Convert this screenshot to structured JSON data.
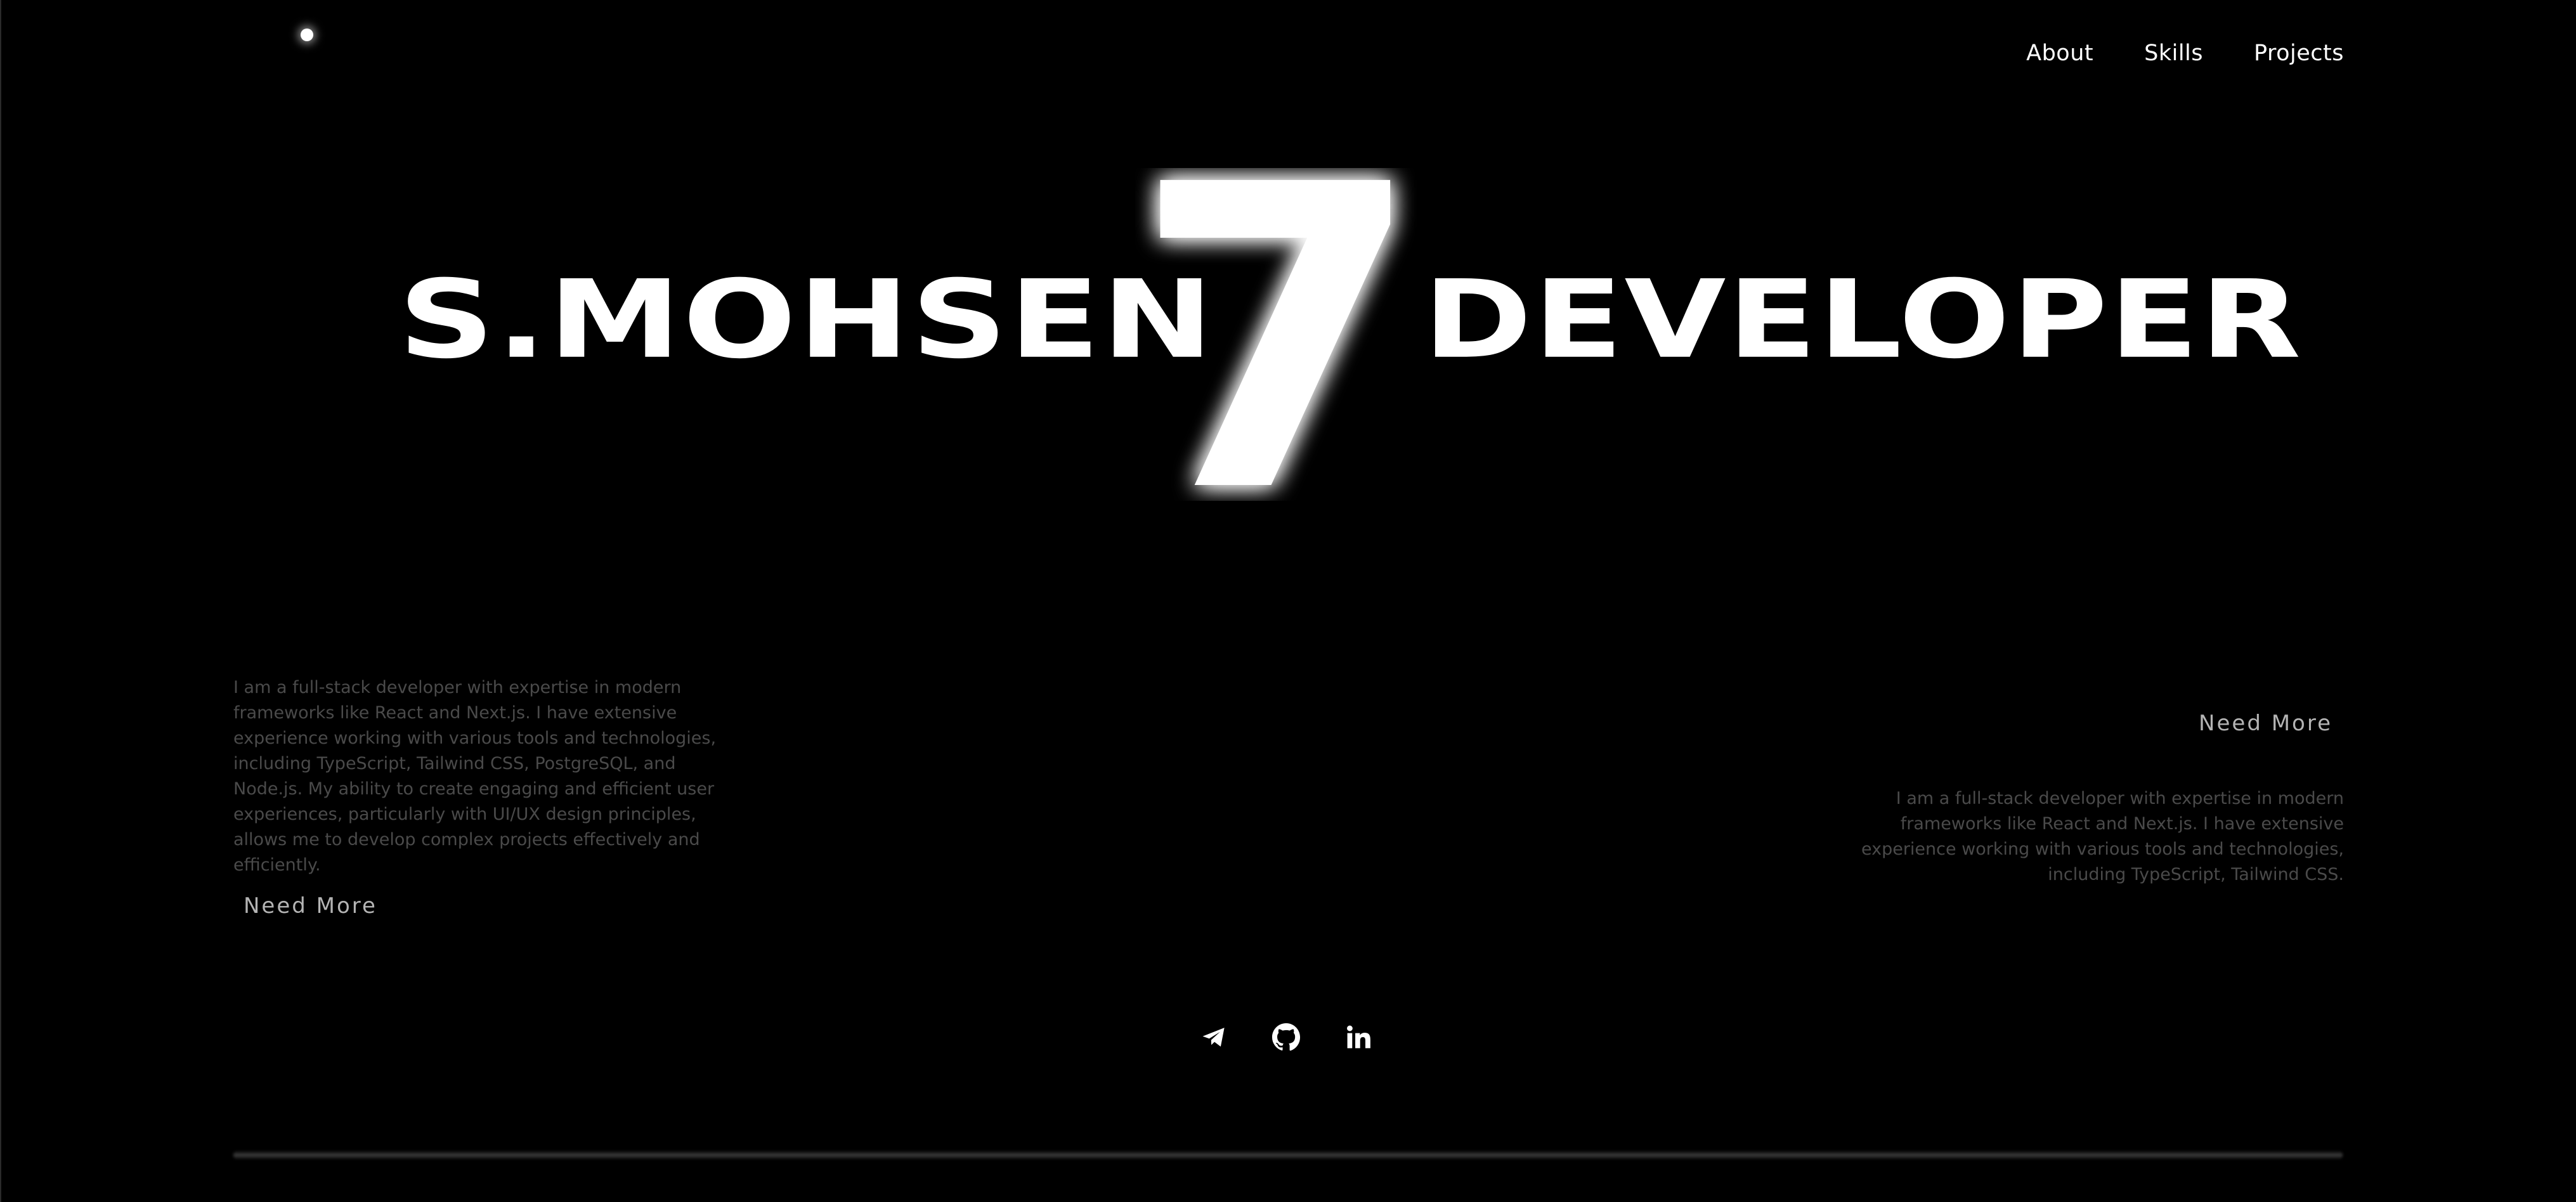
{
  "nav": {
    "items": [
      {
        "label": "About"
      },
      {
        "label": "Skills"
      },
      {
        "label": "Projects"
      }
    ]
  },
  "hero": {
    "left_word": "S.MOHSEN",
    "number": "7",
    "right_word": "DEVELOPER"
  },
  "intro_left": {
    "text": "I am a full-stack developer with expertise in modern frameworks like React and Next.js. I have extensive experience working with various tools and technologies, including TypeScript, Tailwind CSS, PostgreSQL, and Node.js. My ability to create engaging and efficient user experiences, particularly with UI/UX design principles, allows me to develop complex projects effectively and efficiently.",
    "button_label": "Need More"
  },
  "intro_right": {
    "text": "I am a full-stack developer with expertise in modern frameworks like React and Next.js. I have extensive experience working with various tools and technologies, including TypeScript, Tailwind CSS.",
    "button_label": "Need More"
  },
  "socials": [
    {
      "icon": "telegram-icon"
    },
    {
      "icon": "github-icon"
    },
    {
      "icon": "linkedin-icon"
    }
  ],
  "colors": {
    "background": "#000000",
    "foreground": "#ffffff",
    "muted_text": "#4a4a4a",
    "button_text": "#b4b4b4"
  }
}
